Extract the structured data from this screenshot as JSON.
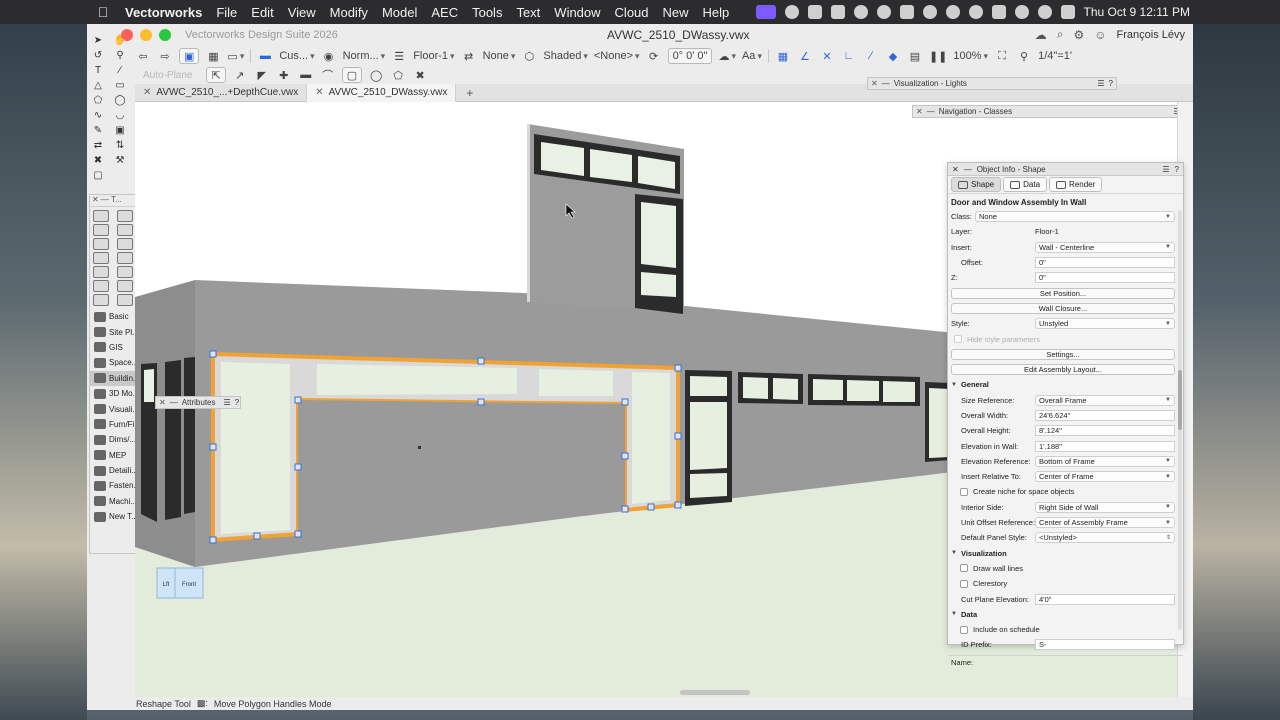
{
  "menubar": {
    "app_name": "Vectorworks",
    "items": [
      "File",
      "Edit",
      "View",
      "Modify",
      "Model",
      "AEC",
      "Tools",
      "Text",
      "Window",
      "Cloud",
      "New",
      "Help"
    ],
    "clock": "Thu Oct 9  12:11 PM"
  },
  "window": {
    "app_title": "Vectorworks Design Suite 2026",
    "doc_title": "AVWC_2510_DWassy.vwx",
    "user_name": "François Lévy"
  },
  "toolbar": {
    "cus_label": "Cus...",
    "render_mode": "Norm...",
    "layer": "Floor-1",
    "class_none": "None",
    "shaded_label": "Shaded",
    "none_option": "<None>",
    "angle": "0° 0' 0\"",
    "zoom": "100%",
    "scale": "1/4\"=1'",
    "autoplane": "Auto-Plane"
  },
  "tabs": [
    {
      "label": "AVWC_2510_...+DepthCue.vwx",
      "active": false
    },
    {
      "label": "AVWC_2510_DWassy.vwx",
      "active": true
    }
  ],
  "tool_sets": {
    "header": "T...",
    "items": [
      {
        "label": "Basic"
      },
      {
        "label": "Site Pl..."
      },
      {
        "label": "GIS"
      },
      {
        "label": "Space..."
      },
      {
        "label": "Buildin...",
        "active": true
      },
      {
        "label": "3D Mo..."
      },
      {
        "label": "Visuali..."
      },
      {
        "label": "Furn/Fi..."
      },
      {
        "label": "Dims/..."
      },
      {
        "label": "MEP"
      },
      {
        "label": "Detaili..."
      },
      {
        "label": "Fasten..."
      },
      {
        "label": "Machi..."
      },
      {
        "label": "New T..."
      }
    ]
  },
  "palettes": {
    "attributes": "Attributes",
    "visualization_lights": "Visualization - Lights",
    "navigation_classes": "Navigation - Classes"
  },
  "view_cube": {
    "left": "Lft",
    "front": "Front"
  },
  "oip": {
    "title": "Object Info - Shape",
    "tabs": [
      "Shape",
      "Data",
      "Render"
    ],
    "object_name": "Door and Window Assembly In Wall",
    "class_label": "Class:",
    "class_value": "None",
    "layer_label": "Layer:",
    "layer_value": "Floor-1",
    "insert_label": "Insert:",
    "insert_value": "Wall - Centerline",
    "offset_label": "Offset:",
    "offset_value": "0\"",
    "z_label": "Z:",
    "z_value": "0\"",
    "set_position": "Set Position...",
    "wall_closure": "Wall Closure...",
    "style_label": "Style:",
    "style_value": "Unstyled",
    "hide_style_params": "Hide style parameters",
    "settings": "Settings...",
    "edit_assembly": "Edit Assembly Layout...",
    "general": "General",
    "size_ref_label": "Size Reference:",
    "size_ref_value": "Overall Frame",
    "overall_width_label": "Overall Width:",
    "overall_width_value": "24'6.624\"",
    "overall_height_label": "Overall Height:",
    "overall_height_value": "8'.124\"",
    "elev_wall_label": "Elevation in Wall:",
    "elev_wall_value": "1'.188\"",
    "elev_ref_label": "Elevation Reference:",
    "elev_ref_value": "Bottom of Frame",
    "insert_rel_label": "Insert Relative To:",
    "insert_rel_value": "Center of Frame",
    "create_niche": "Create niche for space objects",
    "interior_side_label": "Interior Side:",
    "interior_side_value": "Right Side of Wall",
    "unit_offset_label": "Unit Offset Reference:",
    "unit_offset_value": "Center of Assembly Frame",
    "default_panel_label": "Default Panel Style:",
    "default_panel_value": "<Unstyled>",
    "visualization": "Visualization",
    "draw_wall_lines": "Draw wall lines",
    "clerestory": "Clerestory",
    "cut_plane_label": "Cut Plane Elevation:",
    "cut_plane_value": "4'0\"",
    "data": "Data",
    "include_schedule": "Include on schedule",
    "id_prefix_label": "ID Prefix:",
    "id_prefix_value": "S-",
    "name_label": "Name:"
  },
  "status": {
    "tool": "Reshape Tool",
    "mode": "Move Polygon Handles Mode"
  }
}
